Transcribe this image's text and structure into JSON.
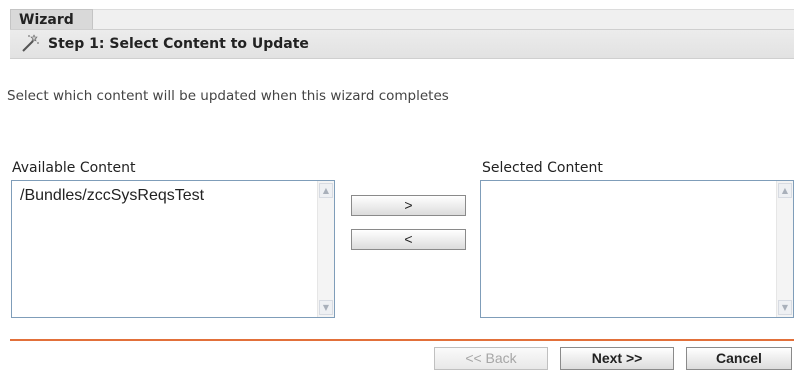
{
  "header": {
    "tab_label": "Wizard",
    "step_title": "Step 1: Select Content to Update"
  },
  "instructions": "Select which content will be updated when this wizard completes",
  "available": {
    "label": "Available Content",
    "items": [
      "/Bundles/zccSysReqsTest"
    ]
  },
  "selected": {
    "label": "Selected Content",
    "items": []
  },
  "transfer": {
    "add_label": ">",
    "remove_label": "<"
  },
  "footer": {
    "back_label": "<< Back",
    "next_label": "Next >>",
    "cancel_label": "Cancel"
  },
  "colors": {
    "divider": "#e2703a",
    "listbox_border": "#7f9db9"
  }
}
